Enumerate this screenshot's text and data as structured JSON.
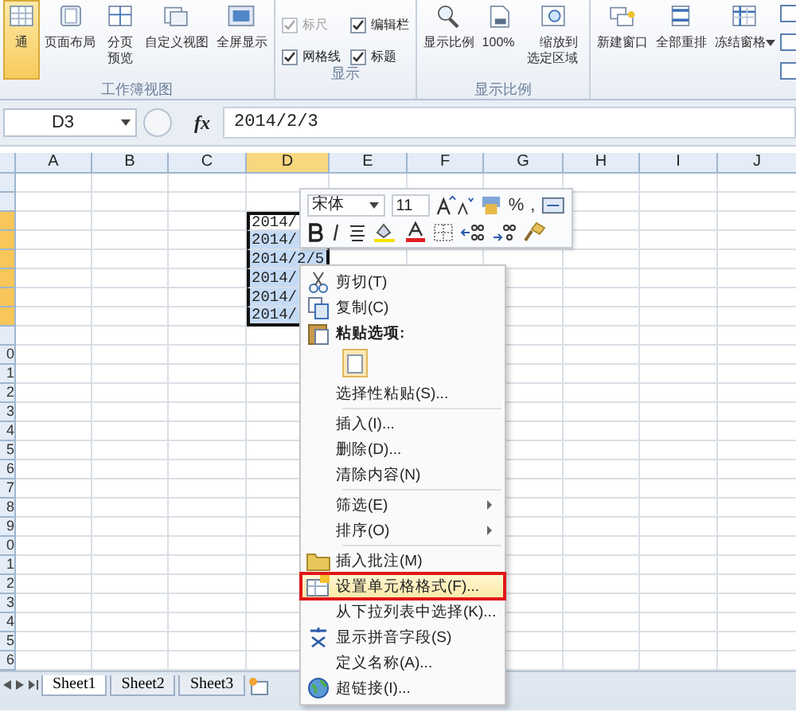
{
  "ribbon": {
    "groups": [
      {
        "label": "工作簿视图",
        "buttons": [
          {
            "kind": "normal",
            "label": "通",
            "selected": true
          },
          {
            "kind": "page",
            "label": "页面布局",
            "selected": false
          },
          {
            "kind": "split",
            "label": "分页预览",
            "selected": false
          },
          {
            "kind": "custom",
            "label": "自定义视图",
            "selected": false
          },
          {
            "kind": "full",
            "label": "全屏显示",
            "selected": false
          }
        ]
      },
      {
        "label": "显示",
        "checks": [
          {
            "label": "标尺",
            "checked": true,
            "disabled": true
          },
          {
            "label": "编辑栏",
            "checked": true,
            "disabled": false
          },
          {
            "label": "网格线",
            "checked": true,
            "disabled": false
          },
          {
            "label": "标题",
            "checked": true,
            "disabled": false
          }
        ]
      },
      {
        "label": "显示比例",
        "buttons": [
          {
            "kind": "zoom",
            "label": "显示比例",
            "selected": false
          },
          {
            "kind": "hundred",
            "label": "100%",
            "selected": false
          },
          {
            "kind": "fit",
            "label": "缩放到选定区域",
            "selected": false
          }
        ]
      },
      {
        "buttons": [
          {
            "kind": "newwin",
            "label": "新建窗口",
            "selected": false
          },
          {
            "kind": "arrange",
            "label": "全部重排",
            "selected": false
          },
          {
            "kind": "freeze",
            "label": "冻结窗格",
            "selected": false
          }
        ]
      }
    ]
  },
  "formula_bar": {
    "name_box": "D3",
    "fx": "fx",
    "value": "2014/2/3"
  },
  "sheet": {
    "columns": [
      {
        "label": "A",
        "selected": false
      },
      {
        "label": "B",
        "selected": false
      },
      {
        "label": "C",
        "selected": false
      },
      {
        "label": "D",
        "selected": true
      },
      {
        "label": "E",
        "selected": false
      },
      {
        "label": "F",
        "selected": false
      },
      {
        "label": "G",
        "selected": false
      },
      {
        "label": "H",
        "selected": false
      },
      {
        "label": "I",
        "selected": false
      },
      {
        "label": "J",
        "selected": false
      }
    ],
    "rows": [
      {
        "selected": false
      },
      {
        "selected": false
      },
      {
        "selected": true,
        "cells": [
          {
            "text": "2014/",
            "selected": true,
            "active": true
          }
        ]
      },
      {
        "selected": true,
        "cells": [
          {
            "text": "2014/",
            "selected": true,
            "active": false
          }
        ]
      },
      {
        "selected": true,
        "cells": [
          {
            "text": "2014/2/5",
            "selected": true,
            "active": false
          }
        ]
      },
      {
        "selected": true,
        "cells": [
          {
            "text": "2014/",
            "selected": true,
            "active": false
          }
        ]
      },
      {
        "selected": true,
        "cells": [
          {
            "text": "2014/",
            "selected": true,
            "active": false
          }
        ]
      },
      {
        "selected": true,
        "cells": [
          {
            "text": "2014/",
            "selected": true,
            "active": false
          }
        ]
      },
      {
        "selected": false
      },
      {
        "header": "0",
        "selected": false
      },
      {
        "header": "1",
        "selected": false
      },
      {
        "header": "2",
        "selected": false
      },
      {
        "header": "3",
        "selected": false
      },
      {
        "header": "4",
        "selected": false
      },
      {
        "header": "5",
        "selected": false
      },
      {
        "header": "6",
        "selected": false
      },
      {
        "header": "7",
        "selected": false
      },
      {
        "header": "8",
        "selected": false
      },
      {
        "header": "9",
        "selected": false
      },
      {
        "header": "0",
        "selected": false
      },
      {
        "header": "1",
        "selected": false
      },
      {
        "header": "2",
        "selected": false
      },
      {
        "header": "3",
        "selected": false
      },
      {
        "header": "4",
        "selected": false
      },
      {
        "header": "5",
        "selected": false
      },
      {
        "header": "6",
        "selected": false
      }
    ]
  },
  "sheet_tabs": [
    {
      "label": "Sheet1",
      "selected": true
    },
    {
      "label": "Sheet2",
      "selected": false
    },
    {
      "label": "Sheet3",
      "selected": false
    }
  ],
  "mini_toolbar": {
    "font": "宋体",
    "size": "11",
    "percent": "%",
    "comma": ","
  },
  "context_menu": [
    {
      "kind": "cut",
      "label": "剪切(T)",
      "selected": false
    },
    {
      "kind": "copy",
      "label": "复制(C)",
      "selected": false
    },
    {
      "kind": "paste-header",
      "label": "粘贴选项:"
    },
    {
      "kind": "paste-option"
    },
    {
      "kind": "command",
      "label": "选择性粘贴(S)...",
      "selected": false
    },
    {
      "kind": "separator"
    },
    {
      "kind": "command",
      "label": "插入(I)...",
      "selected": false
    },
    {
      "kind": "command",
      "label": "删除(D)...",
      "selected": false
    },
    {
      "kind": "command",
      "label": "清除内容(N)",
      "selected": false
    },
    {
      "kind": "separator"
    },
    {
      "kind": "submenu",
      "label": "筛选(E)",
      "selected": false
    },
    {
      "kind": "submenu",
      "label": "排序(O)",
      "selected": false
    },
    {
      "kind": "separator"
    },
    {
      "kind": "comment",
      "label": "插入批注(M)",
      "selected": false
    },
    {
      "kind": "format",
      "label": "设置单元格格式(F)...",
      "selected": true
    },
    {
      "kind": "command",
      "label": "从下拉列表中选择(K)...",
      "selected": false
    },
    {
      "kind": "phonetic",
      "label": "显示拼音字段(S)",
      "selected": false
    },
    {
      "kind": "command",
      "label": "定义名称(A)...",
      "selected": false
    },
    {
      "kind": "link",
      "label": "超链接(I)...",
      "selected": false
    }
  ]
}
